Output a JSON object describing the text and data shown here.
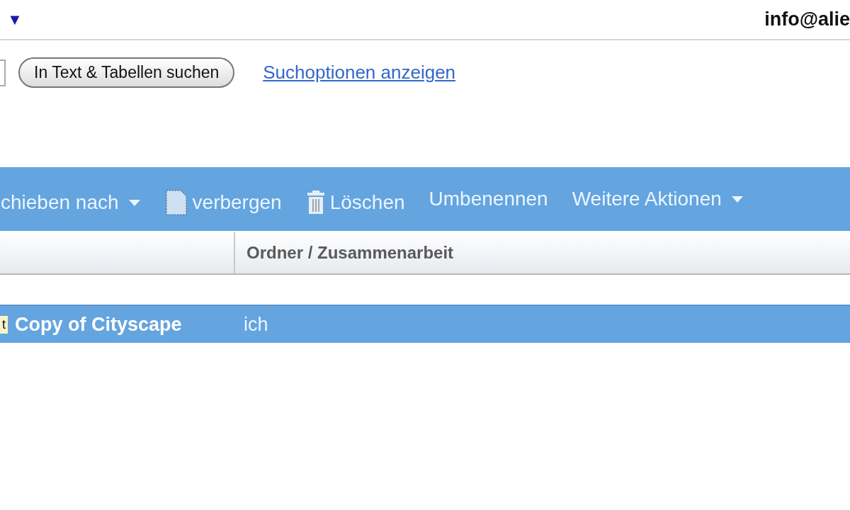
{
  "header": {
    "menu_caret": "▼",
    "account": "info@alie"
  },
  "search": {
    "button": "In Text & Tabellen suchen",
    "link": "Suchoptionen anzeigen"
  },
  "toolbar": [
    {
      "kind": "menu",
      "label": "chieben nach"
    },
    {
      "kind": "hide",
      "label": "verbergen"
    },
    {
      "kind": "delete",
      "label": "Löschen"
    },
    {
      "kind": "plain",
      "label": "Umbenennen"
    },
    {
      "kind": "menu",
      "label": "Weitere Aktionen"
    }
  ],
  "table": {
    "column_2": "Ordner / Zusammenarbeit",
    "rows": [
      {
        "tag": "t",
        "name": "Copy of Cityscape",
        "column_2": "ich",
        "selected": true
      }
    ]
  }
}
